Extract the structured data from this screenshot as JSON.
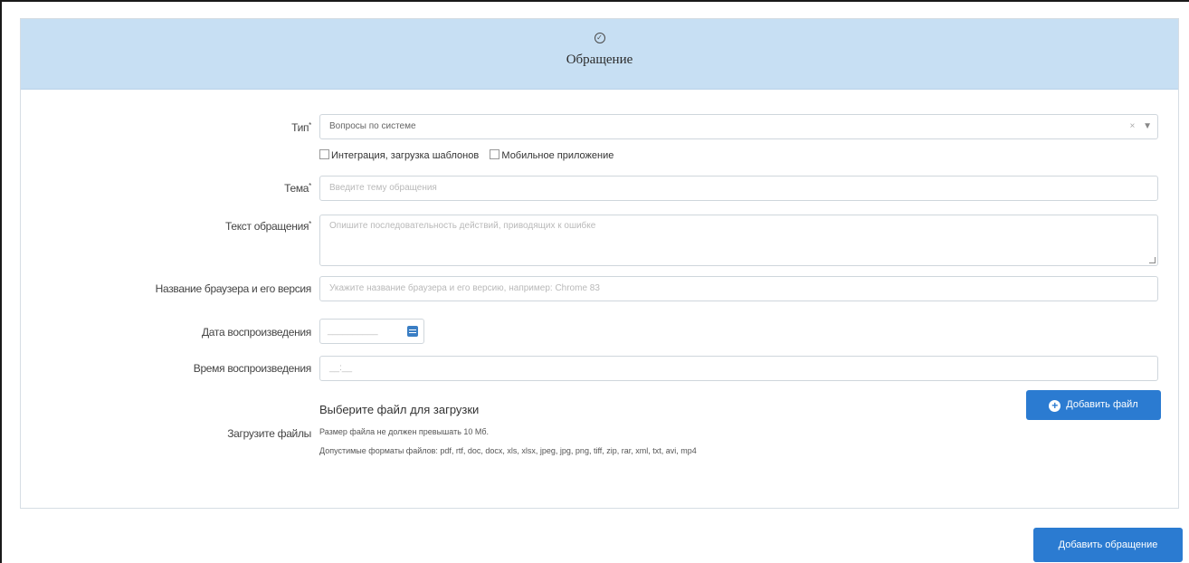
{
  "header": {
    "title": "Обращение"
  },
  "form": {
    "type": {
      "label": "Тип",
      "required_mark": "*",
      "value": "Вопросы по системе",
      "clear": "×",
      "arrow": "▼",
      "options": [
        {
          "label": "Интеграция, загрузка шаблонов",
          "checked": false
        },
        {
          "label": "Мобильное приложение",
          "checked": false
        }
      ]
    },
    "subject": {
      "label": "Тема",
      "required_mark": "*",
      "placeholder": "Введите тему обращения"
    },
    "text": {
      "label": "Текст обращения",
      "required_mark": "*",
      "placeholder": "Опишите последовательность действий, приводящих к ошибке"
    },
    "browser": {
      "label": "Название браузера и его версия",
      "placeholder": "Укажите название браузера и его версию, например: Chrome 83"
    },
    "repro_date": {
      "label": "Дата воспроизведения",
      "placeholder": "__________"
    },
    "repro_time": {
      "label": "Время воспроизведения",
      "placeholder": "__:__"
    },
    "upload": {
      "label": "Загрузите файлы",
      "title": "Выберите файл для загрузки",
      "size_note": "Размер файла не должен превышать 10 Мб.",
      "formats_note": "Допустимые форматы файлов: pdf, rtf, doc, docx, xls, xlsx, jpeg, jpg, png, tiff, zip, rar, xml, txt, avi, mp4",
      "add_button": "Добавить файл"
    }
  },
  "submit_button": "Добавить обращение",
  "colors": {
    "header_bg": "#c7dff3",
    "button": "#2b7bd1"
  }
}
